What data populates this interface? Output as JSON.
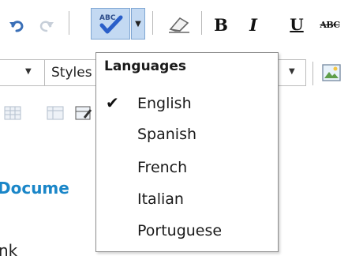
{
  "toolbar": {
    "spellcheck_icon_label": "ABC",
    "bold_label": "B",
    "italic_label": "I",
    "underline_label": "U",
    "strikethrough_label": "ABC"
  },
  "format_bar": {
    "style_combo_label": "Styles"
  },
  "language_menu": {
    "title": "Languages",
    "items": [
      {
        "label": "English",
        "checked": true
      },
      {
        "label": "Spanish",
        "checked": false
      },
      {
        "label": "French",
        "checked": false
      },
      {
        "label": "Italian",
        "checked": false
      },
      {
        "label": "Portuguese",
        "checked": false
      }
    ],
    "check_glyph": "✔"
  },
  "document": {
    "heading": "Docume",
    "body_text": "nk"
  },
  "colors": {
    "heading": "#1a86c8",
    "highlight": "#c3d9f2"
  }
}
